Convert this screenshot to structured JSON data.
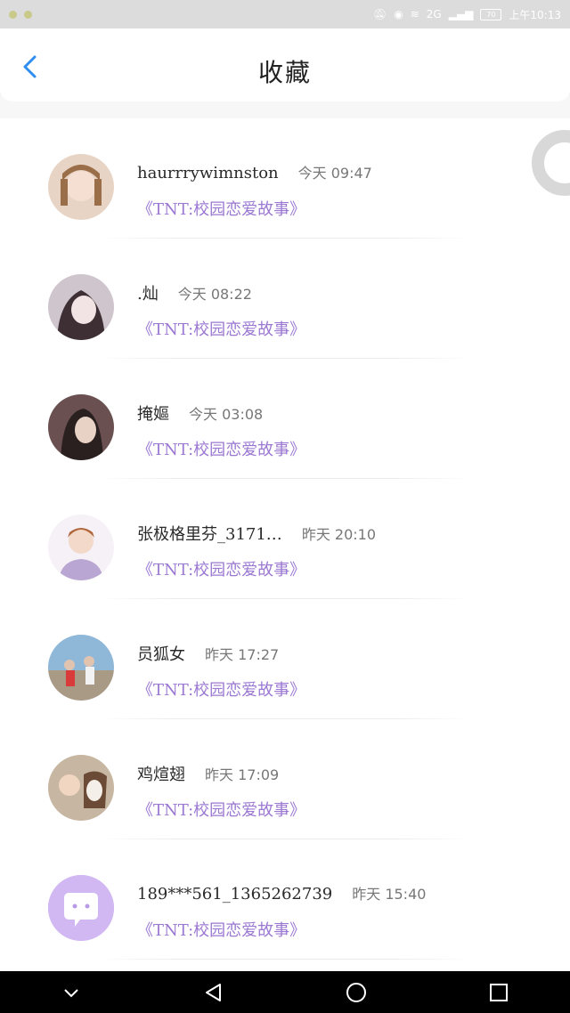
{
  "status_bar": {
    "time": "上午10:13",
    "battery": "70",
    "network": "2G"
  },
  "header": {
    "title": "收藏",
    "back_icon": "chevron-left-icon",
    "accent_color": "#2d8ef0"
  },
  "items": [
    {
      "name": "haurrrywimnston",
      "time": "今天 09:47",
      "link": "《TNT:校园恋爱故事》",
      "avatar_color": "#e8d4c4"
    },
    {
      "name": ".灿",
      "time": "今天 08:22",
      "link": "《TNT:校园恋爱故事》",
      "avatar_color": "#b7a8b4"
    },
    {
      "name": "掩嫗",
      "time": "今天 03:08",
      "link": "《TNT:校园恋爱故事》",
      "avatar_color": "#6a5050"
    },
    {
      "name": "张极格里芬_3171…",
      "time": "昨天 20:10",
      "link": "《TNT:校园恋爱故事》",
      "avatar_color": "#efe4f1"
    },
    {
      "name": "员狐女",
      "time": "昨天 17:27",
      "link": "《TNT:校园恋爱故事》",
      "avatar_color": "#8fb7d8"
    },
    {
      "name": "鸡煊翅",
      "time": "昨天 17:09",
      "link": "《TNT:校园恋爱故事》",
      "avatar_color": "#c7b7a2"
    },
    {
      "name": "189***561_1365262739",
      "time": "昨天 15:40",
      "link": "《TNT:校园恋爱故事》",
      "avatar_color": "#d1b8f2"
    }
  ],
  "colors": {
    "link": "#9b78d2",
    "nav_background": "#000000"
  }
}
